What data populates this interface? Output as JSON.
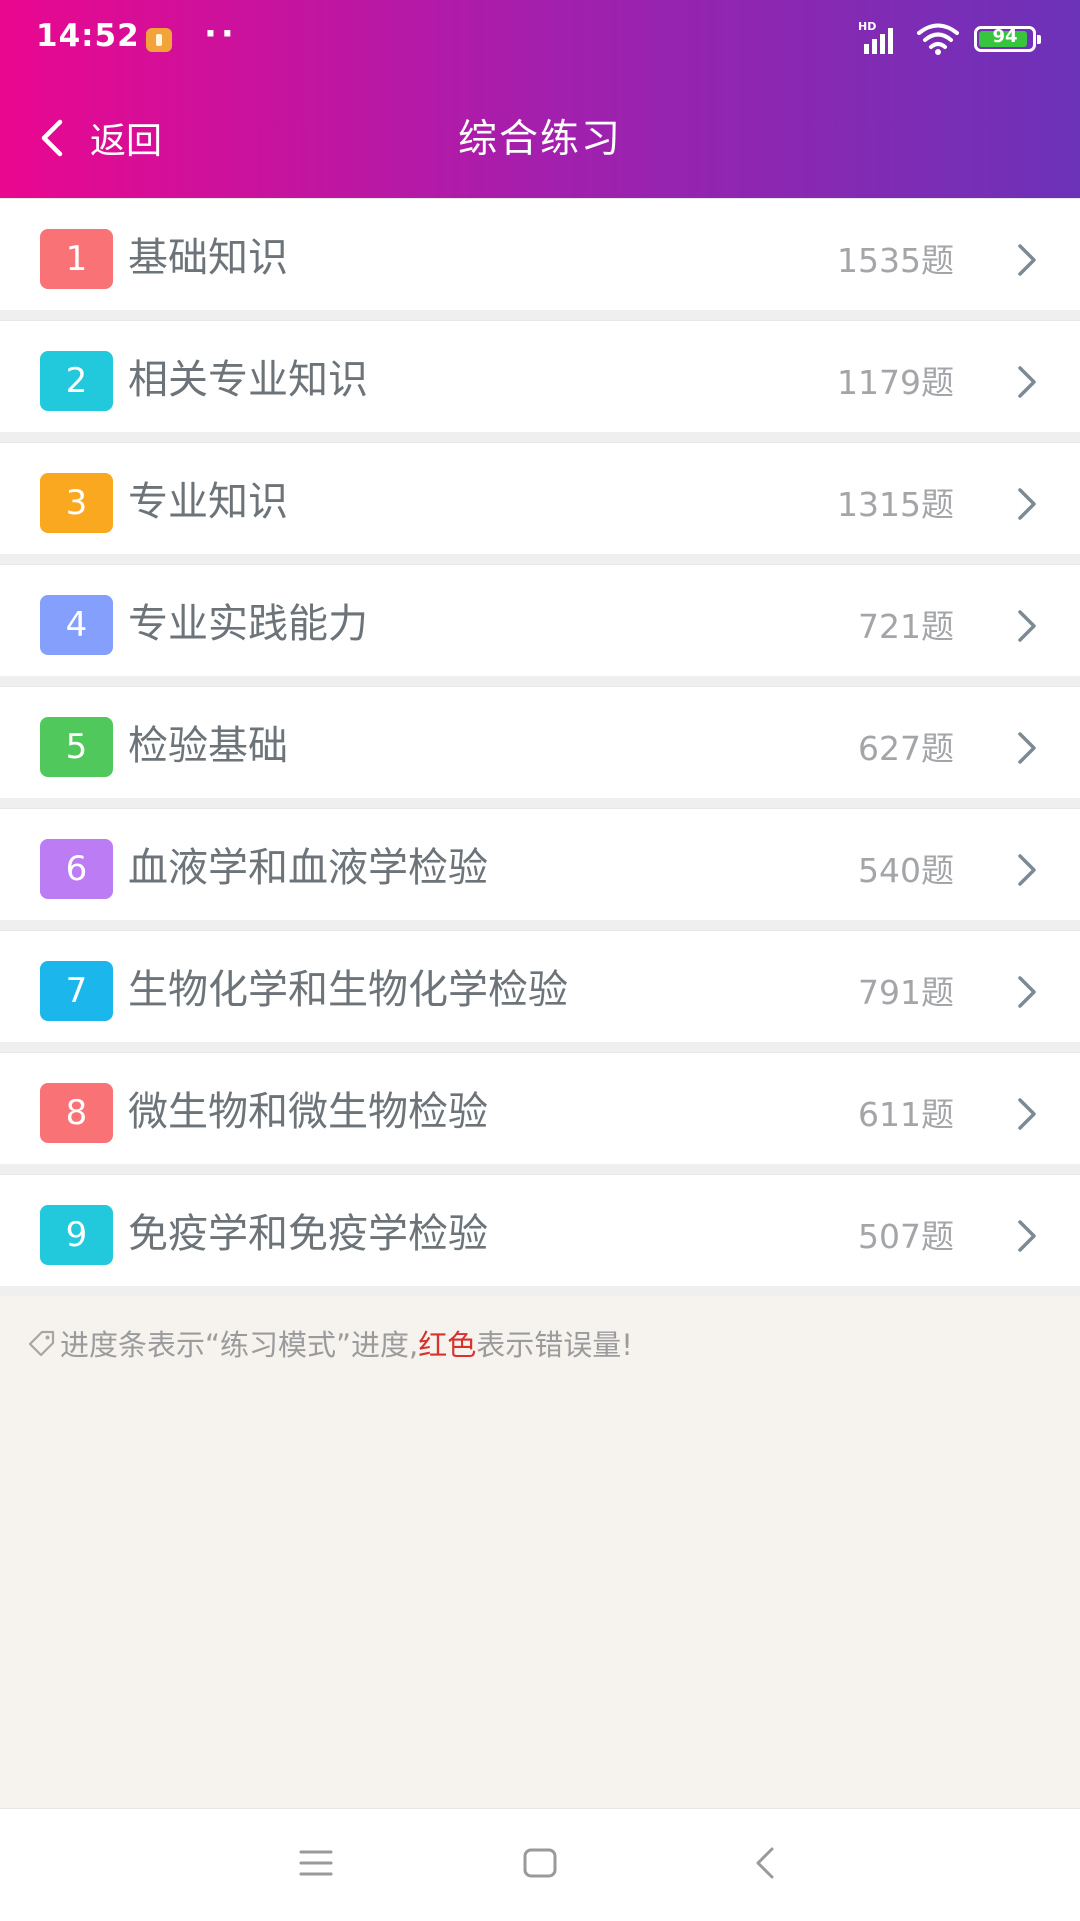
{
  "status_bar": {
    "time": "14:52",
    "network_label": "HD",
    "battery_level": "94"
  },
  "header": {
    "back_label": "返回",
    "title": "综合练习"
  },
  "items": [
    {
      "index": "1",
      "label": "基础知识",
      "count": "1535题",
      "color": "#f87276"
    },
    {
      "index": "2",
      "label": "相关专业知识",
      "count": "1179题",
      "color": "#22c9dc"
    },
    {
      "index": "3",
      "label": "专业知识",
      "count": "1315题",
      "color": "#f9a81f"
    },
    {
      "index": "4",
      "label": "专业实践能力",
      "count": "721题",
      "color": "#84a0fc"
    },
    {
      "index": "5",
      "label": "检验基础",
      "count": "627题",
      "color": "#51c85b"
    },
    {
      "index": "6",
      "label": "血液学和血液学检验",
      "count": "540题",
      "color": "#bb7cf4"
    },
    {
      "index": "7",
      "label": "生物化学和生物化学检验",
      "count": "791题",
      "color": "#1ab6ec"
    },
    {
      "index": "8",
      "label": "微生物和微生物检验",
      "count": "611题",
      "color": "#f87276"
    },
    {
      "index": "9",
      "label": "免疫学和免疫学检验",
      "count": "507题",
      "color": "#22c9dc"
    }
  ],
  "hint": {
    "prefix": "进度条表示“练习模式”进度,",
    "highlight": "红色",
    "suffix": "表示错误量!",
    "highlight_color": "#d7322d"
  },
  "icons": {
    "back": "chevron-left-icon",
    "item_arrow": "chevron-right-icon",
    "hint": "tag-icon",
    "nav": [
      "menu-icon",
      "home-square-icon",
      "back-triangle-icon"
    ]
  }
}
